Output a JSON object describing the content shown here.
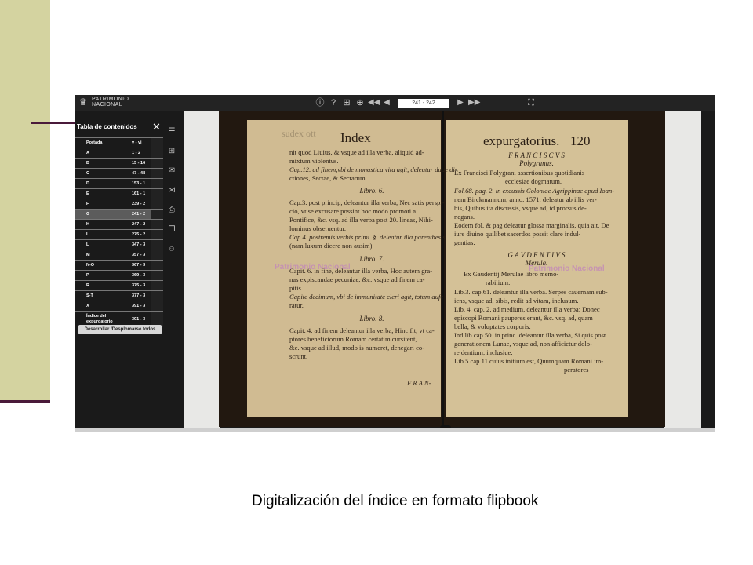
{
  "caption": "Digitalización del índice en formato flipbook",
  "viewer": {
    "logo_text": [
      "PATRIMONIO",
      "NACIONAL"
    ],
    "page_indicator": "241 - 242",
    "toolbar_icons": [
      "info-icon",
      "help-icon",
      "thumbnails-icon",
      "zoom-in-icon",
      "first-page-icon",
      "previous-page-icon",
      "next-page-icon",
      "last-page-icon",
      "fullscreen-icon"
    ]
  },
  "toc": {
    "title": "Tabla de contenidos",
    "items": [
      {
        "label": "Portada",
        "page": "v - vi"
      },
      {
        "label": "A",
        "page": "1 - 2"
      },
      {
        "label": "B",
        "page": "15 - 16"
      },
      {
        "label": "C",
        "page": "47 - 48"
      },
      {
        "label": "D",
        "page": "153 - 1"
      },
      {
        "label": "E",
        "page": "161 - 1"
      },
      {
        "label": "F",
        "page": "239 - 2"
      },
      {
        "label": "G",
        "page": "241 - 2"
      },
      {
        "label": "H",
        "page": "247 - 2"
      },
      {
        "label": "I",
        "page": "275 - 2"
      },
      {
        "label": "L",
        "page": "347 - 3"
      },
      {
        "label": "M",
        "page": "357 - 3"
      },
      {
        "label": "N-O",
        "page": "367 - 3"
      },
      {
        "label": "P",
        "page": "369 - 3"
      },
      {
        "label": "R",
        "page": "375 - 3"
      },
      {
        "label": "S-T",
        "page": "377 - 3"
      },
      {
        "label": "X",
        "page": "391 - 3"
      },
      {
        "label": "Índice del expurgatorio",
        "page": "391 - 3"
      }
    ],
    "active_item": "G",
    "toggle_button": "Desarrollar /Desplomarse todos"
  },
  "side_icons": [
    "list-icon",
    "grid-icon",
    "mail-icon",
    "share-icon",
    "print-icon",
    "bookmark-icon",
    "user-icon"
  ],
  "book": {
    "left_page": {
      "header": "Index",
      "lines": [
        "nit quod Liuius, & vsque ad illa verba, aliquid ad-",
        "mixtum violentus.",
        "Cap.12. ad finem,vbi de monastica vita agit, deleatur duae di-",
        "ctiones, Sectae, & Sectarum.",
        "Libro. 6.",
        "Cap.3. post princip, deleantur illa verba, Nec satis perspi-",
        "cio, vt se excusare possint hoc modo promoti a",
        "Pontifice, &c. vsq. ad illa verba post 20. lineas, Nihi-",
        "lominus obseruentur.",
        "Cap.4. postremis verbis primi. §. deleatur illa parenthesis",
        "(nam luxum dicere non ausim)",
        "Libro. 7.",
        "Capit. 6. in fine, deleantur illa verba, Hoc autem gra-",
        "nas expiscandae pecuniae, &c. vsque ad finem ca-",
        "pitis.",
        "Capite decimum, vbi de immunitate cleri agit, totum aufe-",
        "ratur.",
        "Libro. 8.",
        "Capit. 4. ad finem deleantur illa verba, Hinc fit, vt ca-",
        "ptores beneficiorum Romam certatim cursitent,",
        "&c. vsque ad illud, modo is numeret, denegari co-",
        "scrunt.",
        "F R A N-"
      ]
    },
    "right_page": {
      "header": "expurgatorius.",
      "page_number": "120",
      "lines": [
        "F R A N C I S C V S",
        "Polygranus.",
        "Ex Francisci Polygrani assertionibus quotidianis",
        "ecclesiae dogmatum.",
        "Fol.68. pag. 2. in excussis Coloniae Agrippinae apud Ioan-",
        "nem Birckmannum, anno. 1571. deleatur ab illis ver-",
        "bis, Quibus ita discussis, vsque ad, id prorsus de-",
        "negans.",
        "Eodem fol. & pag deleatur glossa marginalis, quia ait, De",
        "iure diuino quilibet sacerdos possit clare indul-",
        "gentias.",
        "G A V D E N T I V S",
        "Merula.",
        "Ex Gaudentij Merulae libro memo-",
        "rabilium.",
        "Lib.3. cap.61. deleantur illa verba. Serpes cauernam sub-",
        "iens, vsque ad, sibis, redit ad vitam, inclusum.",
        "Lib. 4. cap. 2. ad medium, deleantur illa verba: Donec",
        "episcopi Romani pauperes erant, &c. vsq. ad, quam",
        "bella, & voluptates corporis.",
        "Ind.lib.cap.50. in princ. deleantur illa verba, Si quis post",
        "generationem Lunae, vsque ad, non afficietur dolo-",
        "re dentium, inclusiue.",
        "Lib.5.cap.11.cuius initium est, Quumquam Romani im-",
        "peratores"
      ]
    },
    "watermark": "Patrimonio Nacional"
  }
}
